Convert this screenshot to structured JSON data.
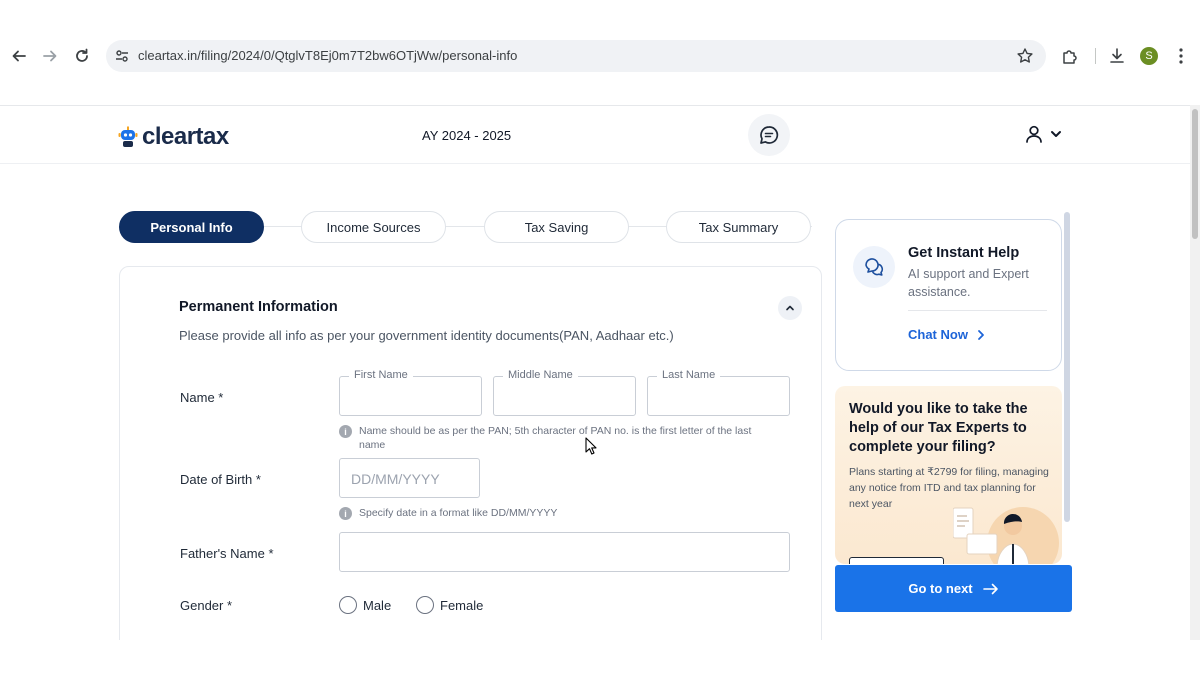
{
  "browser": {
    "url": "cleartax.in/filing/2024/0/QtglvT8Ej0m7T2bw6OTjWw/personal-info",
    "profile_initial": "S",
    "profile_color": "#6b8e23"
  },
  "header": {
    "brand": "cleartax",
    "assessment_year": "AY 2024 - 2025",
    "icons": [
      "chat-bubble-icon",
      "user-icon",
      "chevron-down-icon"
    ]
  },
  "steps": [
    {
      "label": "Personal Info",
      "active": true
    },
    {
      "label": "Income Sources",
      "active": false
    },
    {
      "label": "Tax Saving",
      "active": false
    },
    {
      "label": "Tax Summary",
      "active": false
    }
  ],
  "form": {
    "section_title": "Permanent Information",
    "section_description": "Please provide all info as per your government identity documents(PAN, Aadhaar etc.)",
    "name": {
      "label": "Name *",
      "first_label": "First Name",
      "middle_label": "Middle Name",
      "last_label": "Last Name",
      "first_value": "",
      "middle_value": "",
      "last_value": "",
      "hint": "Name should be as per the PAN; 5th character of PAN no. is the first letter of the last name"
    },
    "dob": {
      "label": "Date of Birth *",
      "placeholder": "DD/MM/YYYY",
      "value": "",
      "hint": "Specify date in a format like DD/MM/YYYY"
    },
    "father": {
      "label": "Father's Name *",
      "value": ""
    },
    "gender": {
      "label": "Gender *",
      "options": [
        "Male",
        "Female"
      ],
      "selected": ""
    }
  },
  "help": {
    "title": "Get Instant Help",
    "subtitle": "AI support and Expert assistance.",
    "link": "Chat Now"
  },
  "promo": {
    "title": "Would you like to take the help of our Tax Experts to complete your filing?",
    "subtitle": "Plans starting at ₹2799 for filing, managing any notice from ITD and tax planning for next year"
  },
  "cta": {
    "label": "Go to next",
    "color": "#1a73e8"
  },
  "colors": {
    "primary_dark": "#0f2f63",
    "link_blue": "#1d64d8"
  }
}
